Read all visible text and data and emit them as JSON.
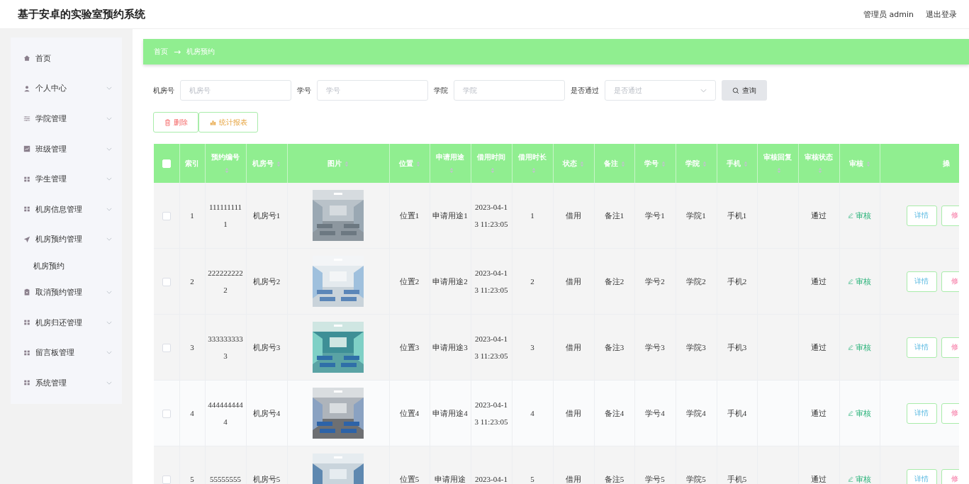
{
  "header": {
    "title": "基于安卓的实验室预约系统",
    "user": "管理员 admin",
    "logout": "退出登录"
  },
  "sidebar": {
    "items": [
      {
        "label": "首页",
        "kind": "link"
      },
      {
        "label": "个人中心",
        "kind": "submenu"
      },
      {
        "label": "学院管理",
        "kind": "submenu"
      },
      {
        "label": "班级管理",
        "kind": "submenu"
      },
      {
        "label": "学生管理",
        "kind": "submenu"
      },
      {
        "label": "机房信息管理",
        "kind": "submenu"
      },
      {
        "label": "机房预约管理",
        "kind": "submenu",
        "children": [
          {
            "label": "机房预约"
          }
        ]
      },
      {
        "label": "取消预约管理",
        "kind": "submenu"
      },
      {
        "label": "机房归还管理",
        "kind": "submenu"
      },
      {
        "label": "留言板管理",
        "kind": "submenu"
      },
      {
        "label": "系统管理",
        "kind": "submenu"
      }
    ]
  },
  "breadcrumb": [
    "首页",
    "→",
    "机房预约"
  ],
  "search": {
    "fields": [
      {
        "label": "机房号",
        "placeholder": "机房号",
        "kind": "input"
      },
      {
        "label": "学号",
        "placeholder": "学号",
        "kind": "input"
      },
      {
        "label": "学院",
        "placeholder": "学院",
        "kind": "input"
      },
      {
        "label": "是否通过",
        "placeholder": "是否通过",
        "kind": "select"
      }
    ],
    "button": "查询"
  },
  "actions": [
    "删除",
    "统计报表"
  ],
  "table": {
    "header_checkbox": {
      "checked": false
    },
    "columns": [
      {
        "label": "索引",
        "sortable": false
      },
      {
        "label": "预约编号",
        "sortable": true
      },
      {
        "label": "机房号",
        "sortable": true
      },
      {
        "label": "图片",
        "sortable": true
      },
      {
        "label": "位置",
        "sortable": true
      },
      {
        "label": "申请用途",
        "sortable": true
      },
      {
        "label": "借用时间",
        "sortable": true
      },
      {
        "label": "借用时长",
        "sortable": true
      },
      {
        "label": "状态",
        "sortable": true
      },
      {
        "label": "备注",
        "sortable": true
      },
      {
        "label": "学号",
        "sortable": true
      },
      {
        "label": "学院",
        "sortable": true
      },
      {
        "label": "手机",
        "sortable": true
      },
      {
        "label": "审核回复",
        "sortable": true
      },
      {
        "label": "审核状态",
        "sortable": true
      },
      {
        "label": "审核",
        "sortable": true
      },
      {
        "label": "操",
        "sortable": false
      }
    ],
    "rows": [
      {
        "checked": false,
        "cells": [
          "1",
          "1111111111",
          "机房号1",
          {
            "kind": "picture"
          },
          "位置1",
          "申请用途1",
          "2023-04-13 11:23:05",
          "1",
          "借用",
          "备注1",
          "学号1",
          "学院1",
          "手机1",
          "",
          "通过"
        ],
        "review": "审核",
        "buttons": [
          "详情",
          "修"
        ]
      },
      {
        "checked": false,
        "cells": [
          "2",
          "2222222222",
          "机房号2",
          {
            "kind": "picture"
          },
          "位置2",
          "申请用途2",
          "2023-04-13 11:23:05",
          "2",
          "借用",
          "备注2",
          "学号2",
          "学院2",
          "手机2",
          "",
          "通过"
        ],
        "review": "审核",
        "buttons": [
          "详情",
          "修"
        ]
      },
      {
        "checked": false,
        "cells": [
          "3",
          "3333333333",
          "机房号3",
          {
            "kind": "picture"
          },
          "位置3",
          "申请用途3",
          "2023-04-13 11:23:05",
          "3",
          "借用",
          "备注3",
          "学号3",
          "学院3",
          "手机3",
          "",
          "通过"
        ],
        "review": "审核",
        "buttons": [
          "详情",
          "修"
        ]
      },
      {
        "checked": false,
        "cells": [
          "4",
          "4444444444",
          "机房号4",
          {
            "kind": "picture"
          },
          "位置4",
          "申请用途4",
          "2023-04-13 11:23:05",
          "4",
          "借用",
          "备注4",
          "学号4",
          "学院4",
          "手机4",
          "",
          "通过"
        ],
        "review": "审核",
        "buttons": [
          "详情",
          "修"
        ]
      },
      {
        "checked": false,
        "cells": [
          "5",
          "55555555",
          "机房号5",
          {
            "kind": "picture"
          },
          "位置5",
          "申请用途",
          "2023-04-1",
          "5",
          "借用",
          "备注5",
          "学号5",
          "学院5",
          "手机5",
          "",
          "通过"
        ],
        "review": "审核",
        "buttons": [
          "详情",
          "修"
        ]
      }
    ]
  }
}
